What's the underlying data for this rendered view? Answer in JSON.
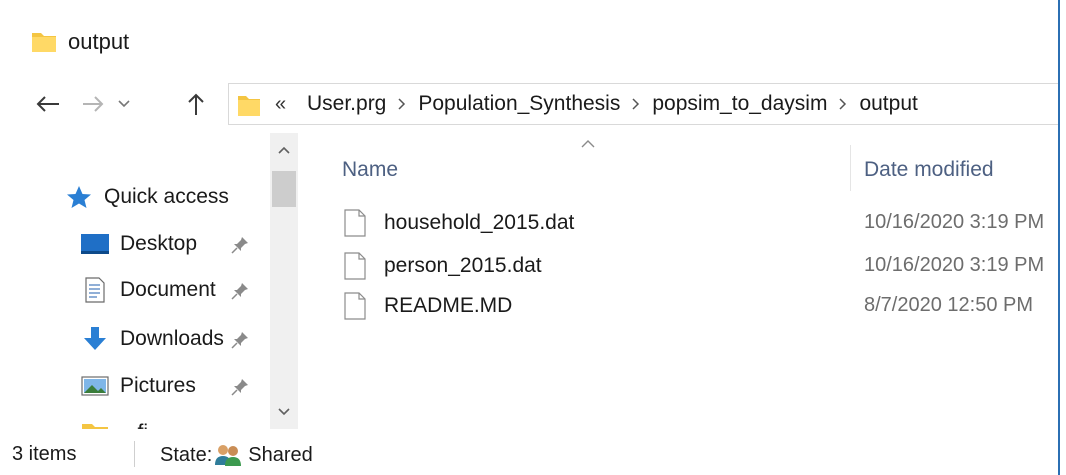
{
  "window": {
    "title": "output"
  },
  "address_bar": {
    "overflow": "«",
    "crumbs": [
      "User.prg",
      "Population_Synthesis",
      "popsim_to_daysim",
      "output"
    ]
  },
  "nav_pane": {
    "items": [
      {
        "label": "Quick access",
        "icon": "star-icon",
        "pinned": false
      },
      {
        "label": "Desktop",
        "icon": "desktop-icon",
        "pinned": true
      },
      {
        "label": "Document",
        "icon": "documents-icon",
        "pinned": true
      },
      {
        "label": "Downloads",
        "icon": "download-icon",
        "pinned": true
      },
      {
        "label": "Pictures",
        "icon": "pictures-icon",
        "pinned": true
      },
      {
        "label": "...fi...",
        "icon": "folder-icon",
        "pinned": false
      }
    ]
  },
  "file_list": {
    "columns": {
      "name": "Name",
      "date": "Date modified"
    },
    "files": [
      {
        "name": "household_2015.dat",
        "date": "10/16/2020 3:19 PM"
      },
      {
        "name": "person_2015.dat",
        "date": "10/16/2020 3:19 PM"
      },
      {
        "name": "README.MD",
        "date": "8/7/2020 12:50 PM"
      }
    ]
  },
  "status_bar": {
    "count": "3 items",
    "state_label": "State:",
    "state_value": "Shared"
  },
  "colors": {
    "folder": "#f4c542",
    "accent": "#2b6fb3",
    "header_text": "#4d6082"
  }
}
